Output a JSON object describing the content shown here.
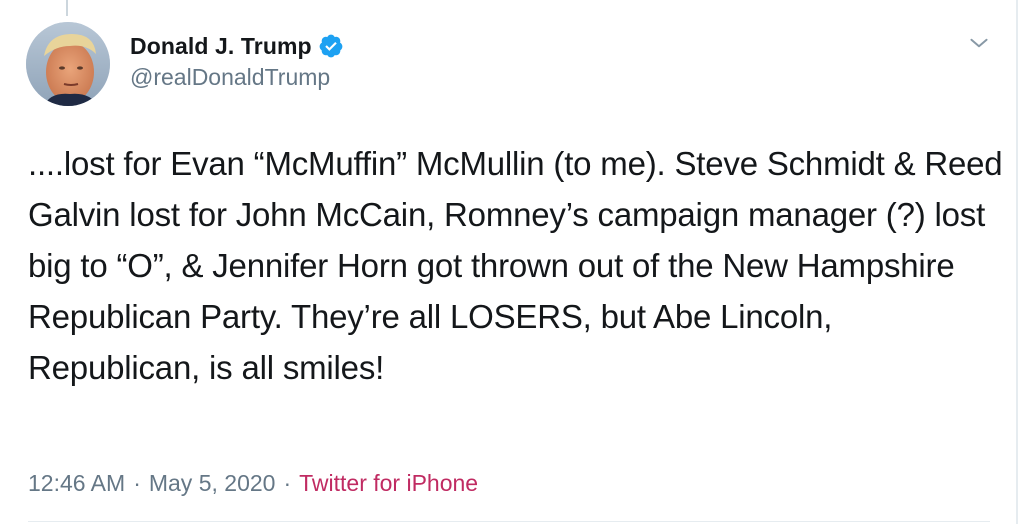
{
  "tweet": {
    "display_name": "Donald J. Trump",
    "handle": "@realDonaldTrump",
    "verified": true,
    "text": "....lost for Evan “McMuffin” McMullin (to me). Steve Schmidt & Reed Galvin lost for John McCain, Romney’s campaign manager (?) lost big to “O”, & Jennifer Horn got thrown out of the New Hampshire Republican Party. They’re all LOSERS, but Abe Lincoln, Republican, is all smiles!",
    "time": "12:46 AM",
    "separator": "·",
    "date": "May 5, 2020",
    "source": "Twitter for iPhone"
  },
  "icons": {
    "verified": "verified-badge-icon",
    "menu": "chevron-down-icon"
  },
  "colors": {
    "name": "#14171a",
    "secondary": "#657786",
    "verified_blue": "#1da1f2",
    "source_link": "#c02b62"
  }
}
